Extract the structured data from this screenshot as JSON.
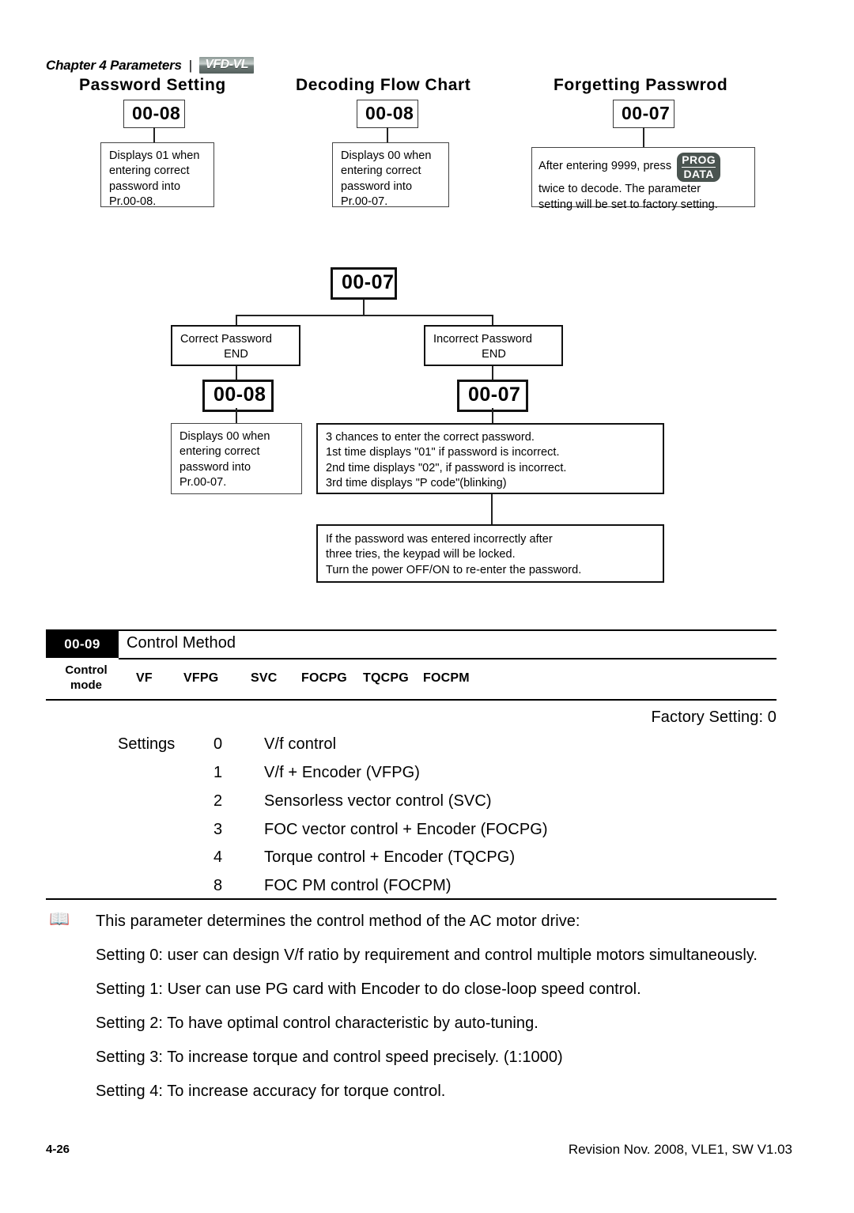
{
  "header": {
    "chapter": "Chapter 4 Parameters",
    "separator": "|",
    "logo": "VFD-VL"
  },
  "columns": {
    "password_setting": "Password Setting",
    "decoding_flow_chart": "Decoding Flow Chart",
    "forgetting_password": "Forgetting Passwrod"
  },
  "flowchart": {
    "badges": {
      "top_left": "00-08",
      "top_middle": "00-08",
      "top_right": "00-07",
      "middle": "00-07",
      "lower_left": "00-08",
      "lower_right": "00-07"
    },
    "box_top_left": [
      "Displays 01 when",
      "entering correct",
      "password into",
      "Pr.00-08."
    ],
    "box_top_middle": [
      "Displays 00 when",
      "entering correct",
      "password into",
      "Pr.00-07."
    ],
    "box_top_right": {
      "line1_before_key": "After entering 9999, press",
      "key_top": "PROG",
      "key_bottom": "DATA",
      "line2": "twice to decode. The parameter",
      "line3": "setting will be set to factory setting."
    },
    "box_correct": {
      "title": "Correct Password",
      "end": "END"
    },
    "box_incorrect": {
      "title": "Incorrect Password",
      "end": "END"
    },
    "box_bottom_left": [
      "Displays 00 when",
      "entering correct",
      "password into",
      "Pr.00-07."
    ],
    "box_chances": [
      "3 chances to enter the correct password.",
      "1st time displays \"01\" if password is incorrect.",
      "2nd time displays \"02\", if password is incorrect.",
      "3rd time displays \"P code\"(blinking)"
    ],
    "box_locked": [
      "If the password was entered incorrectly after",
      "three tries, the keypad will be locked.",
      "Turn the power OFF/ON to re-enter the password."
    ]
  },
  "parameter": {
    "tag": "00-09",
    "name": "Control Method",
    "control_mode_label_line1": "Control",
    "control_mode_label_line2": "mode",
    "modes": [
      "VF",
      "VFPG",
      "SVC",
      "FOCPG",
      "TQCPG",
      "FOCPM"
    ],
    "factory_setting": "Factory Setting: 0",
    "settings_label": "Settings",
    "settings": [
      {
        "value": "0",
        "description": "V/f control"
      },
      {
        "value": "1",
        "description": "V/f + Encoder (VFPG)"
      },
      {
        "value": "2",
        "description": "Sensorless vector control (SVC)"
      },
      {
        "value": "3",
        "description": "FOC vector control + Encoder  (FOCPG)"
      },
      {
        "value": "4",
        "description": "Torque control + Encoder (TQCPG)"
      },
      {
        "value": "8",
        "description": "FOC PM control (FOCPM)"
      }
    ]
  },
  "notes": {
    "icon": "open-book-icon",
    "paragraphs": [
      "This parameter determines the control method of the AC motor drive:",
      "Setting 0: user can design V/f ratio by requirement and control multiple motors simultaneously.",
      "Setting 1: User can use PG card with Encoder to do close-loop speed control.",
      "Setting 2: To have optimal control characteristic by auto-tuning.",
      "Setting 3: To increase torque and control speed precisely. (1:1000)",
      "Setting 4: To increase accuracy for torque control."
    ]
  },
  "footer": {
    "page_number": "4-26",
    "revision": "Revision Nov. 2008, VLE1, SW V1.03"
  }
}
